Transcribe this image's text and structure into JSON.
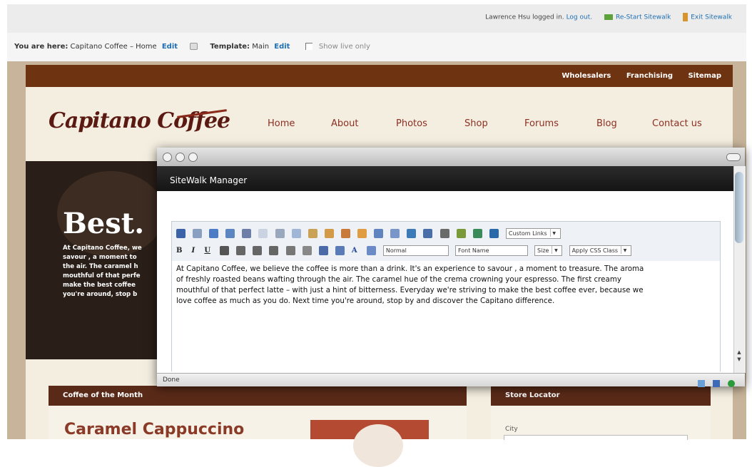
{
  "admin_bar": {
    "user_text": "Lawrence Hsu logged in.",
    "logout": "Log out.",
    "restart": "Re-Start Sitewalk",
    "exit": "Exit Sitewalk"
  },
  "info_bar": {
    "you_are_here_label": "You are here:",
    "page_name": "Capitano Coffee – Home",
    "edit1": "Edit",
    "template_label": "Template:",
    "template_name": "Main",
    "edit2": "Edit",
    "show_live_only": "Show live only"
  },
  "site": {
    "top_links": [
      "Wholesalers",
      "Franchising",
      "Sitemap"
    ],
    "logo": "Capitano Coffee",
    "nav": [
      "Home",
      "About",
      "Photos",
      "Shop",
      "Forums",
      "Blog",
      "Contact us"
    ],
    "hero_title": "Best.",
    "hero_lines": [
      "At Capitano Coffee, we",
      "savour , a moment to",
      "the air. The caramel h",
      "mouthful of that perfe",
      "make the best coffee",
      "you're around, stop b"
    ],
    "coffee_of_month_label": "Coffee of the Month",
    "coffee_of_month_title": "Caramel Cappuccino",
    "store_locator_label": "Store Locator",
    "city_label": "City"
  },
  "window": {
    "title": "SiteWalk Manager",
    "status": "Done",
    "toolbar": {
      "custom_links": "Custom Links",
      "format": "Normal",
      "font_name": "Font Name",
      "size": "Size",
      "css_class": "Apply CSS Class"
    },
    "editor_lines": [
      "At Capitano Coffee, we believe the coffee is more than a drink. It's an experience to savour , a moment to treasure. The aroma",
      "of freshly roasted beans wafting through the air. The caramel hue of the crema crowning your espresso. The first creamy",
      "mouthful of that perfect latte – with just a hint of bitterness. Everyday we're striving to make the best coffee ever, because we",
      "love coffee as much as you do. Next time you're around, stop by and discover the Capitano difference."
    ]
  },
  "colors": {
    "nav_brown": "#6e3311",
    "logo": "#5a1a12",
    "link_blue": "#1f6fb2"
  }
}
